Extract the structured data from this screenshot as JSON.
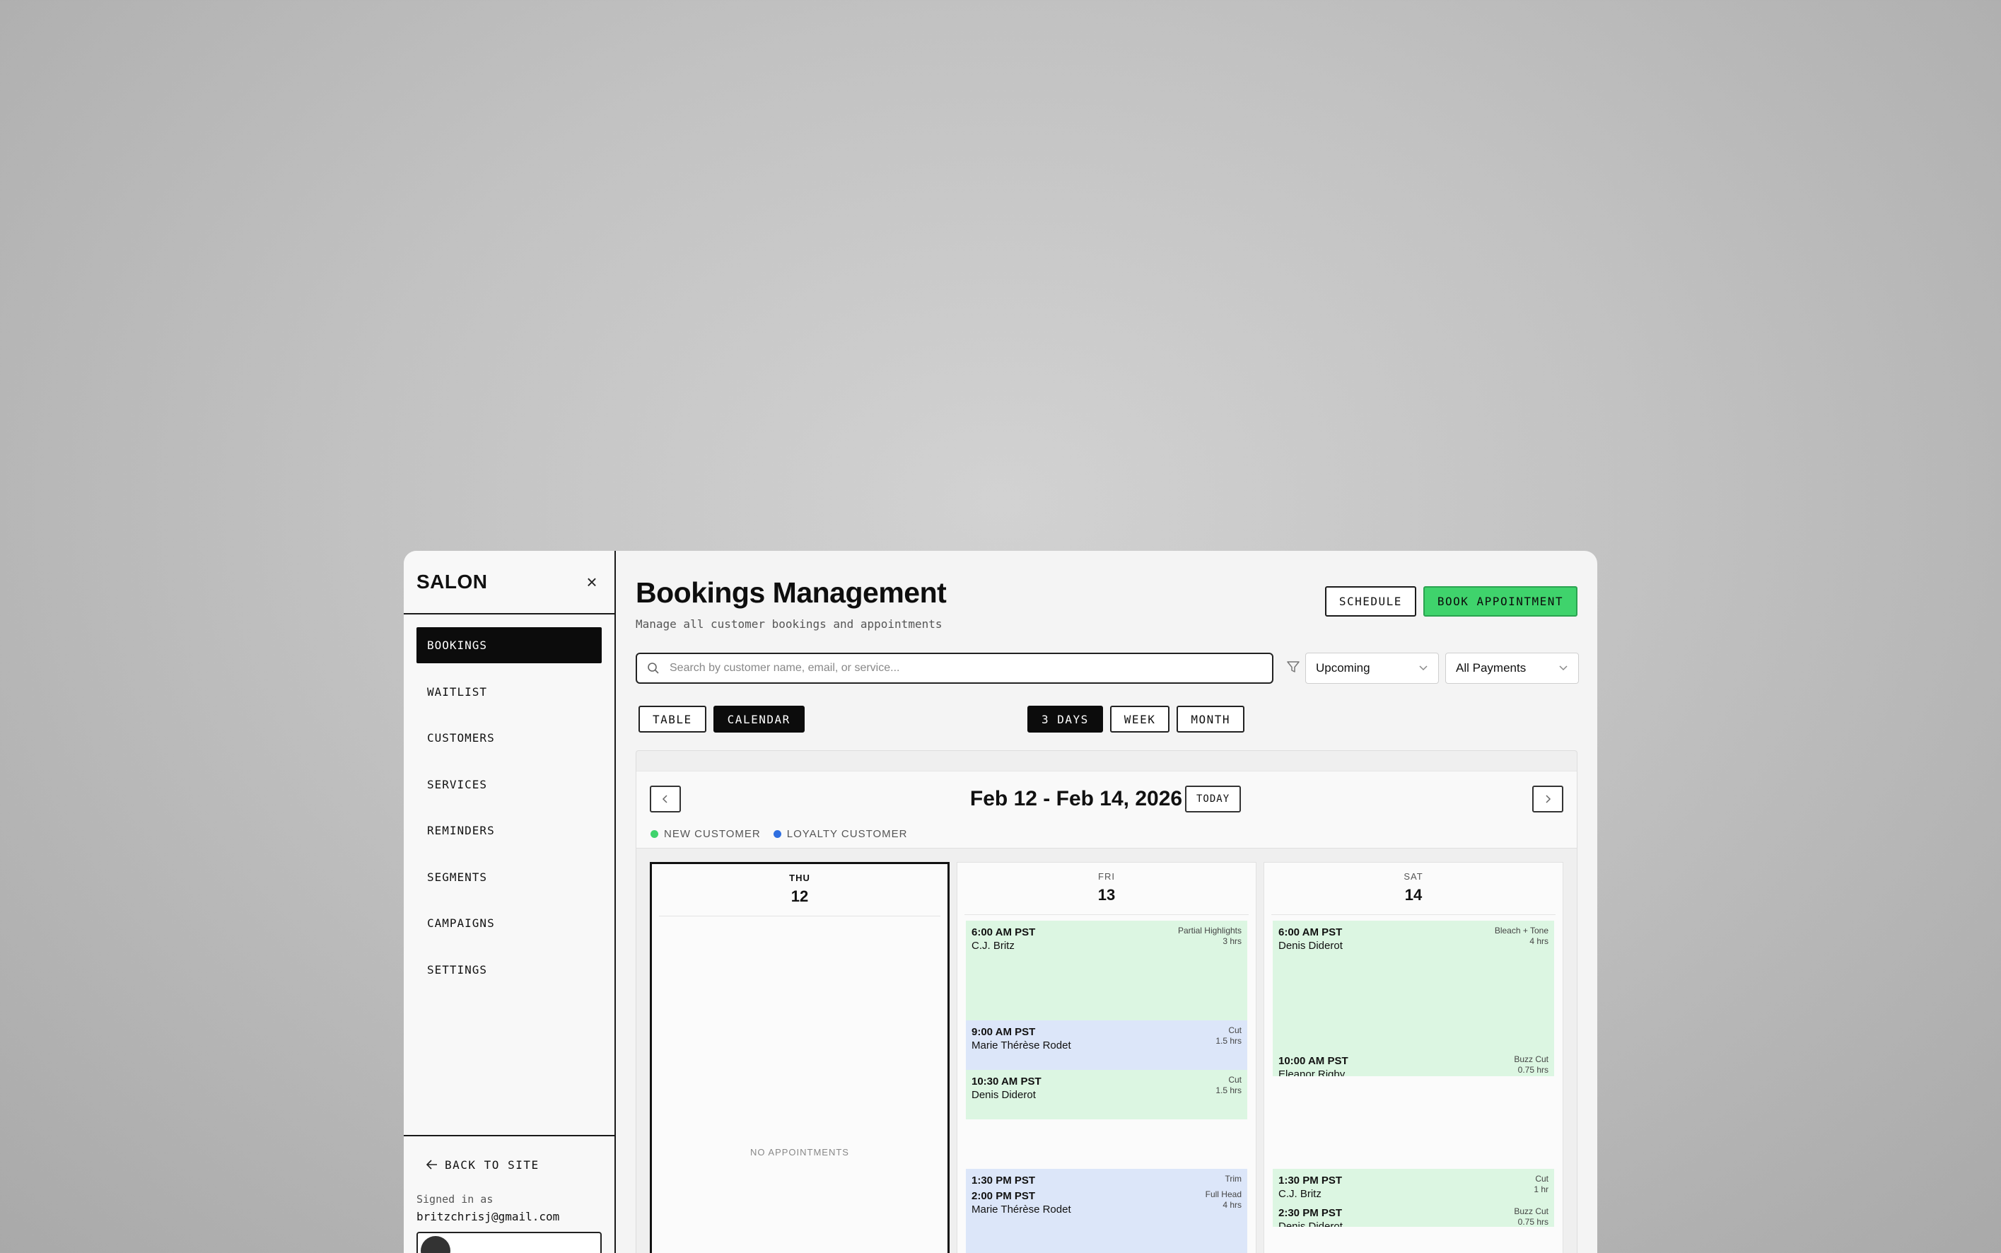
{
  "sidebar": {
    "brand": "SALON",
    "close": "×",
    "items": [
      {
        "label": "BOOKINGS"
      },
      {
        "label": "WAITLIST"
      },
      {
        "label": "CUSTOMERS"
      },
      {
        "label": "SERVICES"
      },
      {
        "label": "REMINDERS"
      },
      {
        "label": "SEGMENTS"
      },
      {
        "label": "CAMPAIGNS"
      },
      {
        "label": "SETTINGS"
      }
    ],
    "back": "BACK TO SITE",
    "signed_label": "Signed in as",
    "email": "britzchrisj@gmail.com"
  },
  "header": {
    "title": "Bookings Management",
    "subtitle": "Manage all customer bookings and appointments",
    "schedule": "SCHEDULE",
    "book": "BOOK APPOINTMENT"
  },
  "search": {
    "placeholder": "Search by customer name, email, or service..."
  },
  "filters": {
    "status": "Upcoming",
    "payments": "All Payments"
  },
  "views": {
    "table": "TABLE",
    "calendar": "CALENDAR",
    "three_days": "3 DAYS",
    "week": "WEEK",
    "month": "MONTH"
  },
  "calendar": {
    "range": "Feb 12 - Feb 14, 2026",
    "today": "TODAY",
    "legend": {
      "new": "NEW CUSTOMER",
      "loyal": "LOYALTY CUSTOMER"
    },
    "colors": {
      "new": "#3fd36c",
      "loyal": "#2f6fe0"
    },
    "days": [
      {
        "dow": "THU",
        "num": "12",
        "empty": "NO APPOINTMENTS"
      },
      {
        "dow": "FRI",
        "num": "13",
        "events": [
          {
            "time": "6:00 AM PST",
            "name": "C.J. Britz",
            "service": "Partial Highlights",
            "dur": "3 hrs"
          },
          {
            "time": "9:00 AM PST",
            "name": "Marie Thérèse Rodet",
            "service": "Cut",
            "dur": "1.5 hrs"
          },
          {
            "time": "10:30 AM PST",
            "name": "Denis Diderot",
            "service": "Cut",
            "dur": "1.5 hrs"
          },
          {
            "time": "1:30 PM PST",
            "service": "Trim"
          },
          {
            "time": "2:00 PM PST",
            "name": "Marie Thérèse Rodet",
            "service": "Full Head",
            "dur": "4 hrs"
          }
        ]
      },
      {
        "dow": "SAT",
        "num": "14",
        "events": [
          {
            "time": "6:00 AM PST",
            "name": "Denis Diderot",
            "service": "Bleach + Tone",
            "dur": "4 hrs"
          },
          {
            "time": "10:00 AM PST",
            "name": "Eleanor Rigby",
            "service": "Buzz Cut",
            "dur": "0.75 hrs"
          },
          {
            "time": "1:30 PM PST",
            "name": "C.J. Britz",
            "service": "Cut",
            "dur": "1 hr"
          },
          {
            "time": "2:30 PM PST",
            "name": "Denis Diderot",
            "service": "Buzz Cut",
            "dur": "0.75 hrs"
          }
        ]
      }
    ]
  }
}
